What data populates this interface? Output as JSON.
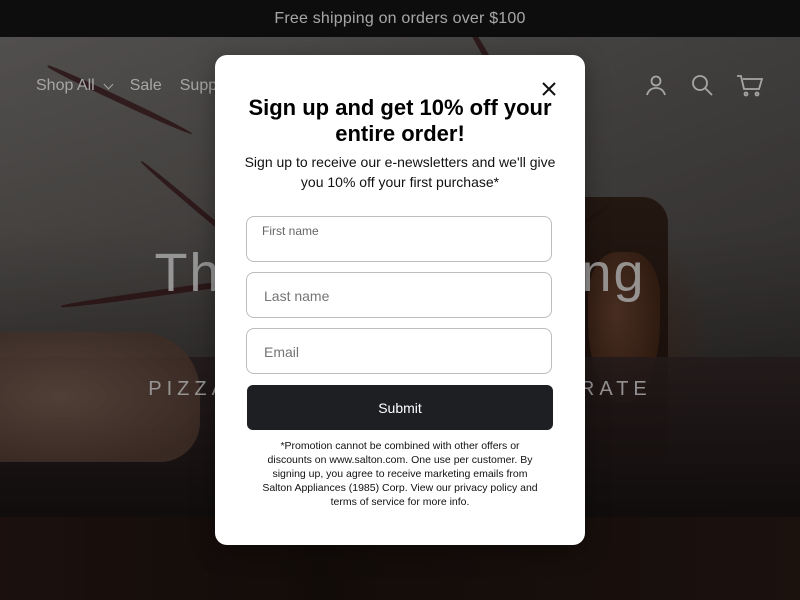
{
  "announcement": {
    "text": "Free shipping on orders over $100"
  },
  "nav": {
    "items": [
      {
        "label": "Shop All",
        "has_dropdown": true
      },
      {
        "label": "Sale",
        "has_dropdown": false
      },
      {
        "label": "Suppo",
        "has_dropdown": false
      }
    ],
    "icons": [
      "account-icon",
      "search-icon",
      "cart-icon"
    ]
  },
  "hero": {
    "title_left": "Th",
    "title_right": "ng",
    "subtitle_left": "PIZZA",
    "subtitle_right": "RATE"
  },
  "modal": {
    "heading": "Sign up and get 10% off your entire order!",
    "subheading": "Sign up to receive our e-newsletters and we'll give you 10% off your first purchase*",
    "fields": {
      "first_name": {
        "label": "First name",
        "value": ""
      },
      "last_name": {
        "placeholder": "Last name"
      },
      "email": {
        "placeholder": "Email"
      }
    },
    "submit_label": "Submit",
    "disclaimer": "*Promotion cannot be combined with other offers or discounts on www.salton.com. One use per customer. By signing up, you agree to receive marketing emails from Salton Appliances (1985) Corp. View our privacy policy and terms of service for more info."
  },
  "colors": {
    "announcement_bg": "#141414",
    "button_bg": "#1e1f22",
    "modal_bg": "#ffffff"
  }
}
